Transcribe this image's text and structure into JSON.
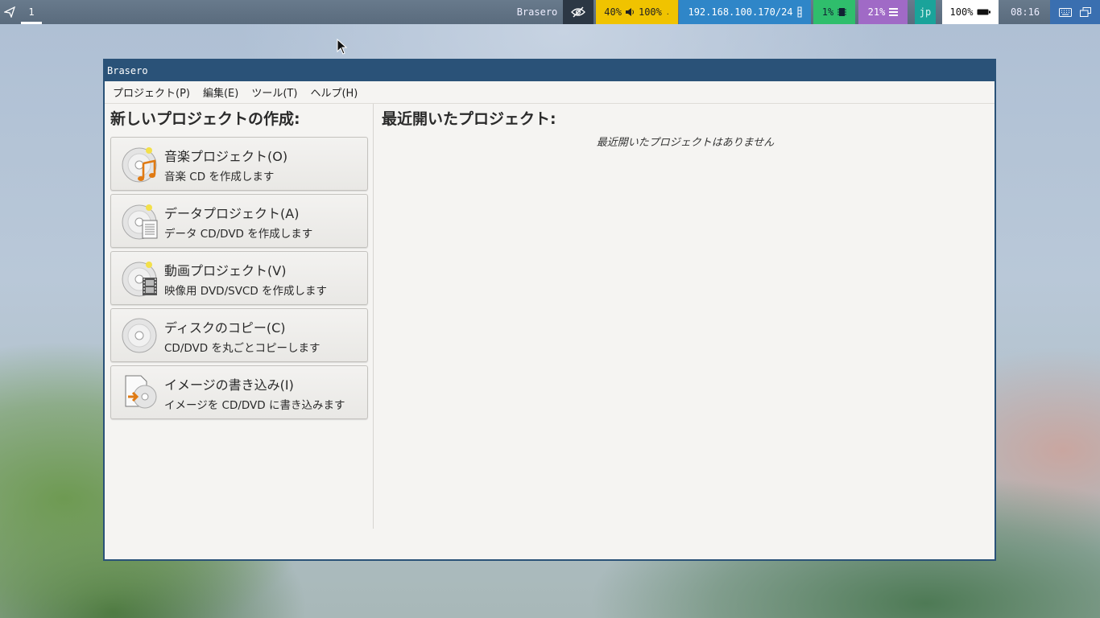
{
  "topbar": {
    "workspace": "1",
    "window_title": "Brasero",
    "volume": "40%",
    "volume2": "100%",
    "ip": "192.168.100.170/24",
    "cpu": "1%",
    "memory": "21%",
    "lang": "jp",
    "battery": "100%",
    "clock": "08:16"
  },
  "window": {
    "title": "Brasero",
    "menu": [
      "プロジェクト(P)",
      "編集(E)",
      "ツール(T)",
      "ヘルプ(H)"
    ]
  },
  "new_projects": {
    "heading": "新しいプロジェクトの作成:",
    "items": [
      {
        "title": "音楽プロジェクト(O)",
        "subtitle": "音楽 CD を作成します",
        "icon": "audio-disc-icon"
      },
      {
        "title": "データプロジェクト(A)",
        "subtitle": "データ CD/DVD を作成します",
        "icon": "data-disc-icon"
      },
      {
        "title": "動画プロジェクト(V)",
        "subtitle": "映像用 DVD/SVCD を作成します",
        "icon": "video-disc-icon"
      },
      {
        "title": "ディスクのコピー(C)",
        "subtitle": "CD/DVD を丸ごとコピーします",
        "icon": "disc-copy-icon"
      },
      {
        "title": "イメージの書き込み(I)",
        "subtitle": "イメージを CD/DVD に書き込みます",
        "icon": "burn-image-icon"
      }
    ]
  },
  "recent": {
    "heading": "最近開いたプロジェクト:",
    "empty": "最近開いたプロジェクトはありません"
  }
}
